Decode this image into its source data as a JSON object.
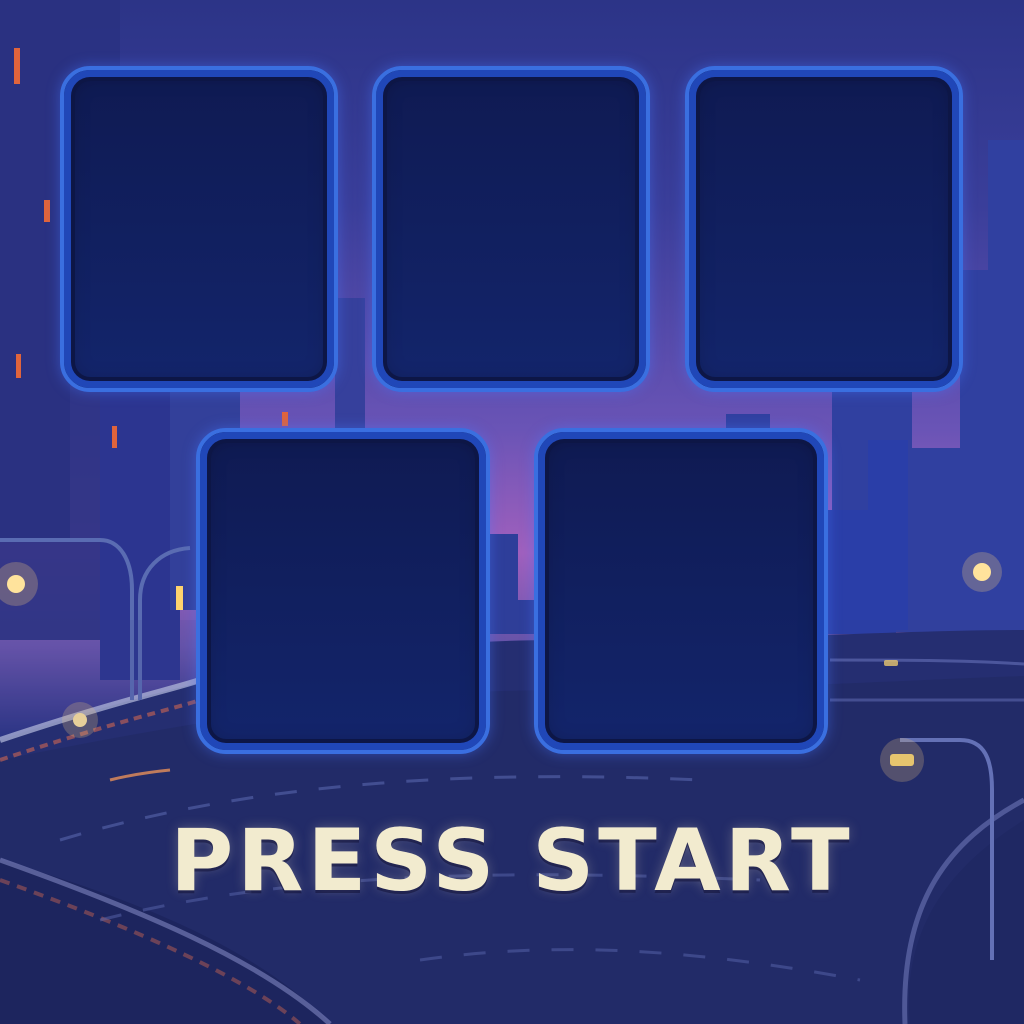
{
  "screen": {
    "prompt_text": "PRESS START",
    "colors": {
      "sky_top": "#2c3487",
      "sky_glow": "#a160bd",
      "slot_fill": "#13256c",
      "slot_border": "#3a6fe0",
      "prompt_text": "#f2ebcf",
      "street_light": "#ffd27a"
    }
  },
  "slots": [
    {
      "state": "empty"
    },
    {
      "state": "empty"
    },
    {
      "state": "empty"
    },
    {
      "state": "empty"
    },
    {
      "state": "empty"
    }
  ]
}
